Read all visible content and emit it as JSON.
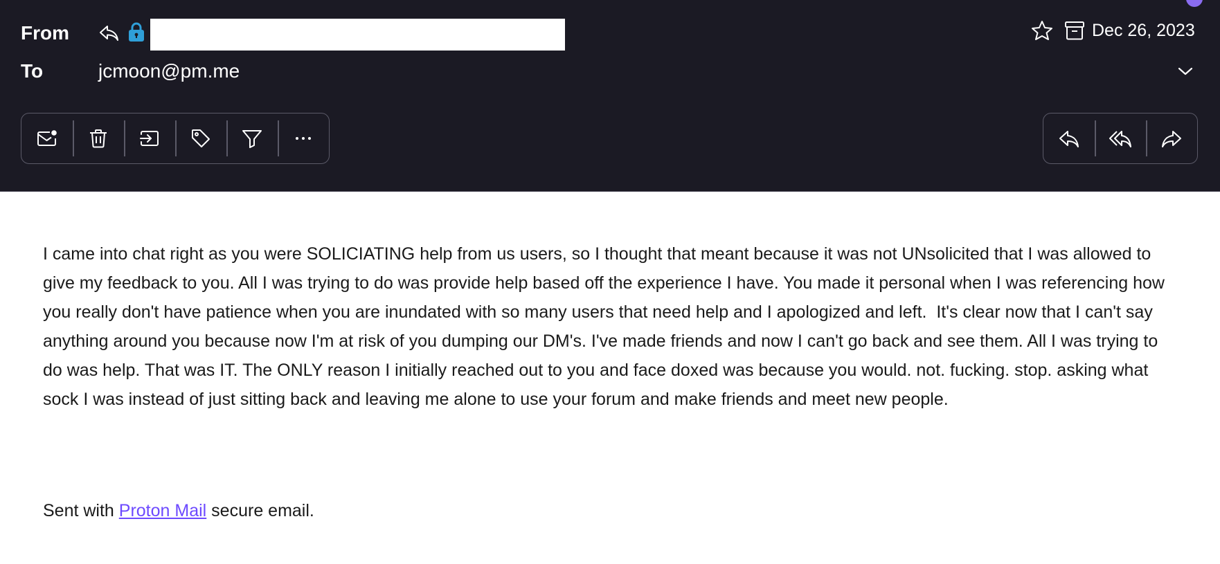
{
  "header": {
    "from_label": "From",
    "to_label": "To",
    "to_address": "jcmoon@pm.me",
    "date": "Dec 26, 2023",
    "icons": {
      "replied": "reply-indicator-icon",
      "encryption": "lock-icon",
      "star": "star-icon",
      "archive": "archive-icon",
      "expand": "chevron-down-icon"
    },
    "colors": {
      "background": "#1b1a24",
      "lock": "#2f9fd8",
      "accent": "#6d4aff"
    }
  },
  "toolbar_left": [
    {
      "icon": "mark-unread-icon"
    },
    {
      "icon": "trash-icon"
    },
    {
      "icon": "move-to-icon"
    },
    {
      "icon": "label-icon"
    },
    {
      "icon": "filter-icon"
    },
    {
      "icon": "more-icon"
    }
  ],
  "toolbar_right": [
    {
      "icon": "reply-icon"
    },
    {
      "icon": "reply-all-icon"
    },
    {
      "icon": "forward-icon"
    }
  ],
  "message": {
    "body": "I came into chat right as you were SOLICIATING help from us users, so I thought that meant because it was not UNsolicited that I was allowed to give my feedback to you. All I was trying to do was provide help based off the experience I have. You made it personal when I was referencing how you really don't have patience when you are inundated with so many users that need help and I apologized and left.  It's clear now that I can't say anything around you because now I'm at risk of you dumping our DM's. I've made friends and now I can't go back and see them. All I was trying to do was help. That was IT. The ONLY reason I initially reached out to you and face doxed was because you would. not. fucking. stop. asking what sock I was instead of just sitting back and leaving me alone to use your forum and make friends and meet new people.",
    "signature_prefix": "Sent with ",
    "signature_link": "Proton Mail",
    "signature_suffix": " secure email."
  }
}
